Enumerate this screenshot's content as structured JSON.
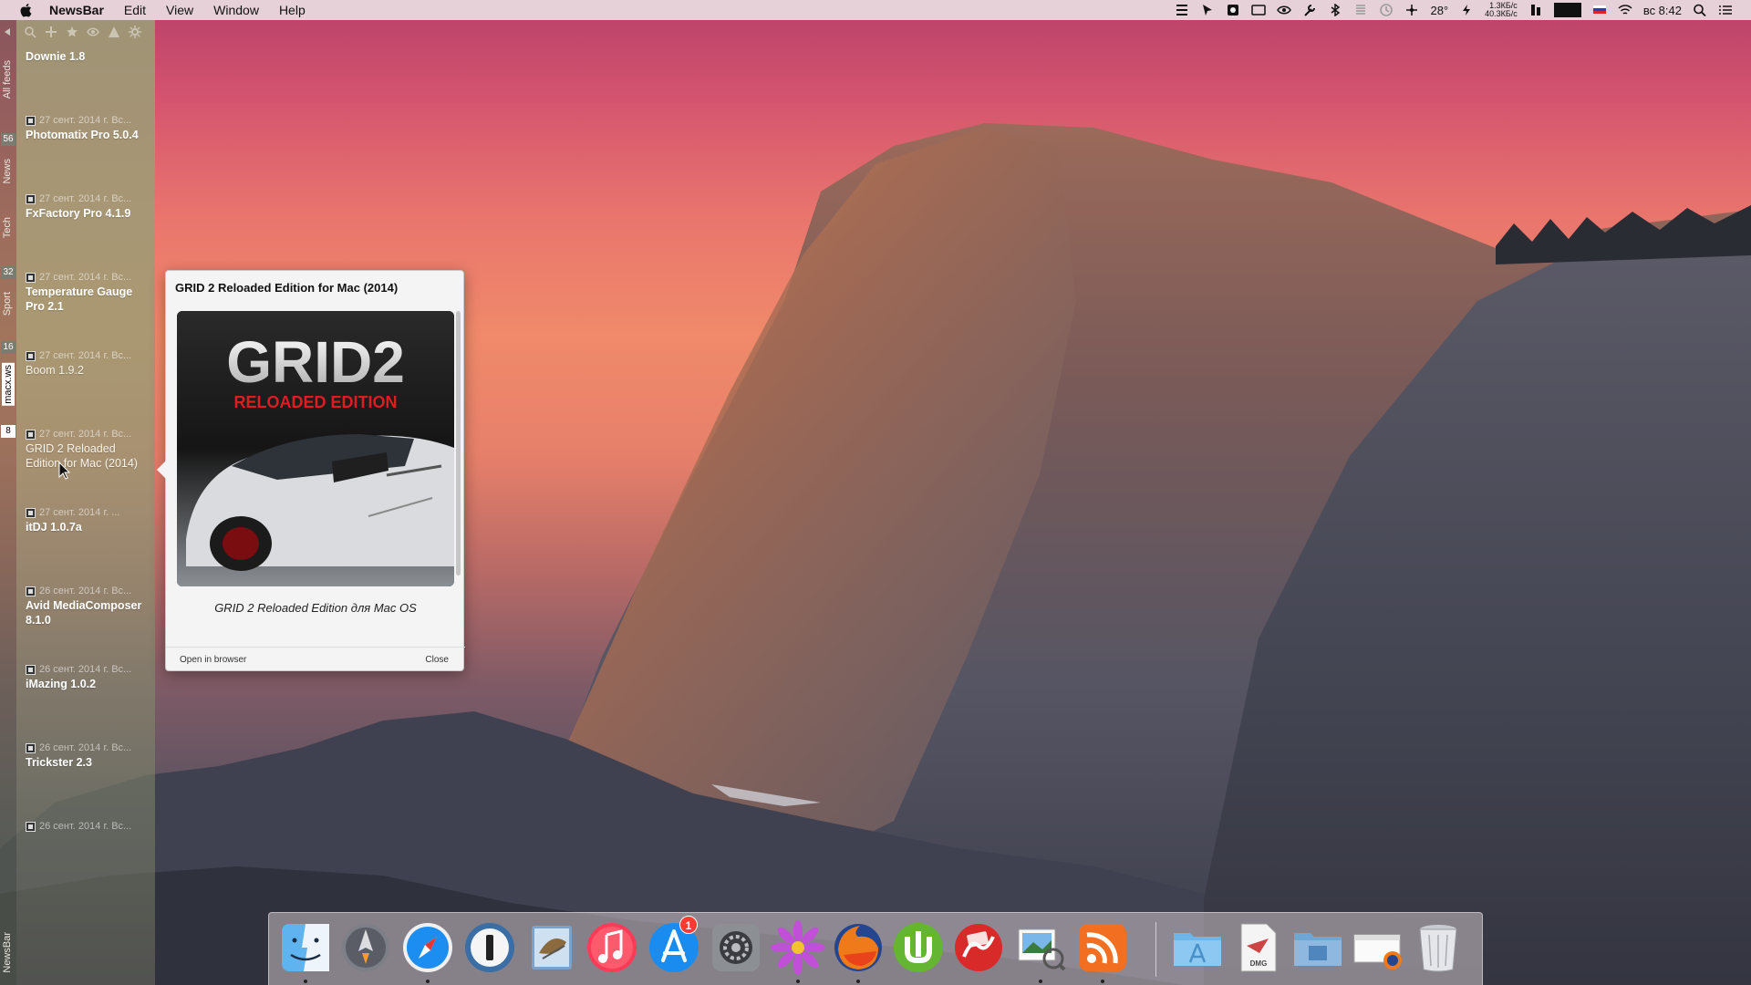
{
  "menubar": {
    "app_name": "NewsBar",
    "menus": [
      "Edit",
      "View",
      "Window",
      "Help"
    ],
    "temperature": "28°",
    "net_up": "1.3КБ/с",
    "net_down": "40.3КБ/с",
    "clock": "вс 8:42"
  },
  "tabs": [
    {
      "label": "All feeds",
      "count": "56"
    },
    {
      "label": "News",
      "count": ""
    },
    {
      "label": "Tech",
      "count": "32"
    },
    {
      "label": "Sport",
      "count": "16"
    },
    {
      "label": "macx.ws",
      "count": "8"
    },
    {
      "label": "NewsBar",
      "count": ""
    }
  ],
  "feed_items": [
    {
      "title": "Downie 1.8",
      "meta": "27 сент. 2014 г. Вс..."
    },
    {
      "title": "Photomatix Pro 5.0.4",
      "meta": "27 сент. 2014 г. Вс..."
    },
    {
      "title": "FxFactory Pro 4.1.9",
      "meta": "27 сент. 2014 г. Вс..."
    },
    {
      "title": "Temperature Gauge Pro 2.1",
      "meta": "27 сент. 2014 г. Вс..."
    },
    {
      "title": "Boom 1.9.2",
      "meta": "27 сент. 2014 г. Вс..."
    },
    {
      "title": "GRID 2 Reloaded Edition for Mac (2014)",
      "meta": "27 сент. 2014 г. ..."
    },
    {
      "title": "itDJ 1.0.7a",
      "meta": "26 сент. 2014 г. Вс..."
    },
    {
      "title": "Avid MediaComposer 8.1.0",
      "meta": "26 сент. 2014 г. Вс..."
    },
    {
      "title": "iMazing 1.0.2",
      "meta": "26 сент. 2014 г. Вс..."
    },
    {
      "title": "Trickster 2.3",
      "meta": "26 сент. 2014 г. Вс..."
    }
  ],
  "popup": {
    "title": "GRID 2 Reloaded Edition for Mac (2014)",
    "image_logo": "GRID2",
    "image_subtitle": "RELOADED EDITION",
    "caption": "GRID 2 Reloaded Edition для Mac OS",
    "open_label": "Open in browser",
    "close_label": "Close"
  },
  "dock": {
    "appstore_badge": "1",
    "dmg_label": "DMG",
    "icons": [
      "finder-icon",
      "launchpad-icon",
      "safari-icon",
      "1password-icon",
      "mail-icon",
      "itunes-icon",
      "app-store-icon",
      "system-preferences-icon",
      "flower-icon",
      "firefox-icon",
      "utorrent-icon",
      "pdf-icon",
      "preview-icon",
      "rss-icon",
      "applications-folder-icon",
      "dmg-icon",
      "documents-folder-icon",
      "downloads-icon",
      "trash-icon"
    ]
  }
}
